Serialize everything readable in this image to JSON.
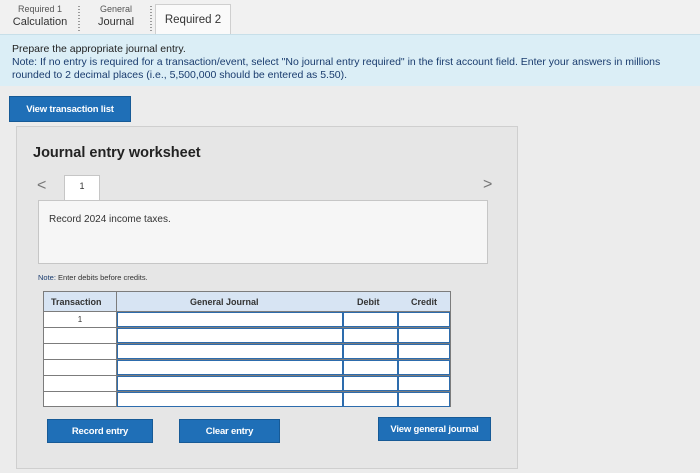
{
  "tabs": [
    {
      "top": "Required 1",
      "label": "Calculation"
    },
    {
      "top": "General",
      "label": "Journal"
    },
    {
      "label": "Required 2"
    }
  ],
  "banner": {
    "line1": "Prepare the appropriate journal entry.",
    "note": "Note: If no entry is required for a transaction/event, select \"No journal entry required\" in the first account field. Enter your answers in millions rounded to 2 decimal places (i.e., 5,500,000 should be entered as 5.50)."
  },
  "buttons": {
    "view_transaction_list": "View transaction list",
    "record_entry": "Record entry",
    "clear_entry": "Clear entry",
    "view_general_journal": "View general journal"
  },
  "worksheet": {
    "title": "Journal entry worksheet",
    "page_number": "1",
    "nav_prev": "<",
    "nav_next": ">",
    "description": "Record 2024 income taxes.",
    "note_label": "Note:",
    "note_text": "Enter debits before credits."
  },
  "journal_table": {
    "headers": [
      "Transaction",
      "General Journal",
      "Debit",
      "Credit"
    ],
    "rows": [
      {
        "transaction": "1",
        "general_journal": "",
        "debit": "",
        "credit": ""
      },
      {
        "transaction": "",
        "general_journal": "",
        "debit": "",
        "credit": ""
      },
      {
        "transaction": "",
        "general_journal": "",
        "debit": "",
        "credit": ""
      },
      {
        "transaction": "",
        "general_journal": "",
        "debit": "",
        "credit": ""
      },
      {
        "transaction": "",
        "general_journal": "",
        "debit": "",
        "credit": ""
      },
      {
        "transaction": "",
        "general_journal": "",
        "debit": "",
        "credit": ""
      }
    ]
  },
  "colors": {
    "button_blue": "#1f6fb7",
    "banner_bg": "#dbeef6",
    "table_header_bg": "#d7e4f3"
  }
}
